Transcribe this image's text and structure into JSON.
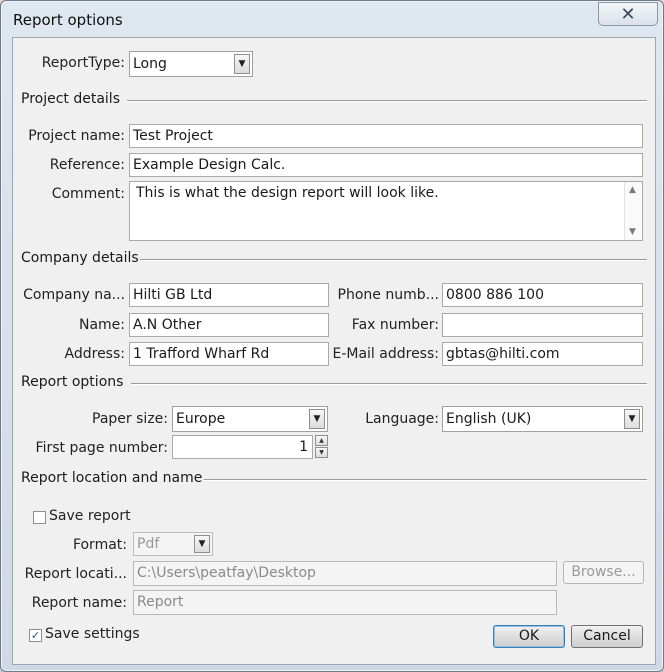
{
  "window": {
    "title": "Report options"
  },
  "report_type": {
    "label": "ReportType:",
    "value": "Long"
  },
  "project_details": {
    "heading": "Project details",
    "project_name_label": "Project name:",
    "project_name_value": "Test Project",
    "reference_label": "Reference:",
    "reference_value": "Example Design Calc.",
    "comment_label": "Comment:",
    "comment_value": "This is what the design report will look like."
  },
  "company_details": {
    "heading": "Company details",
    "company_name_label": "Company na...",
    "company_name_value": "Hilti GB Ltd",
    "name_label": "Name:",
    "name_value": "A.N Other",
    "address_label": "Address:",
    "address_value": "1 Trafford Wharf Rd",
    "phone_label": "Phone numb...",
    "phone_value": "0800 886 100",
    "fax_label": "Fax number:",
    "fax_value": "",
    "email_label": "E-Mail address:",
    "email_value": "gbtas@hilti.com"
  },
  "report_options": {
    "heading": "Report options",
    "paper_size_label": "Paper size:",
    "paper_size_value": "Europe",
    "language_label": "Language:",
    "language_value": "English (UK)",
    "first_page_label": "First page number:",
    "first_page_value": "1"
  },
  "report_location": {
    "heading": "Report location and name",
    "save_report_label": "Save report",
    "format_label": "Format:",
    "format_value": "Pdf",
    "location_label": "Report locati...",
    "location_value": "C:\\Users\\peatfay\\Desktop",
    "browse_label": "Browse...",
    "report_name_label": "Report name:",
    "report_name_value": "Report"
  },
  "footer": {
    "save_settings_label": "Save settings",
    "ok_label": "OK",
    "cancel_label": "Cancel"
  }
}
